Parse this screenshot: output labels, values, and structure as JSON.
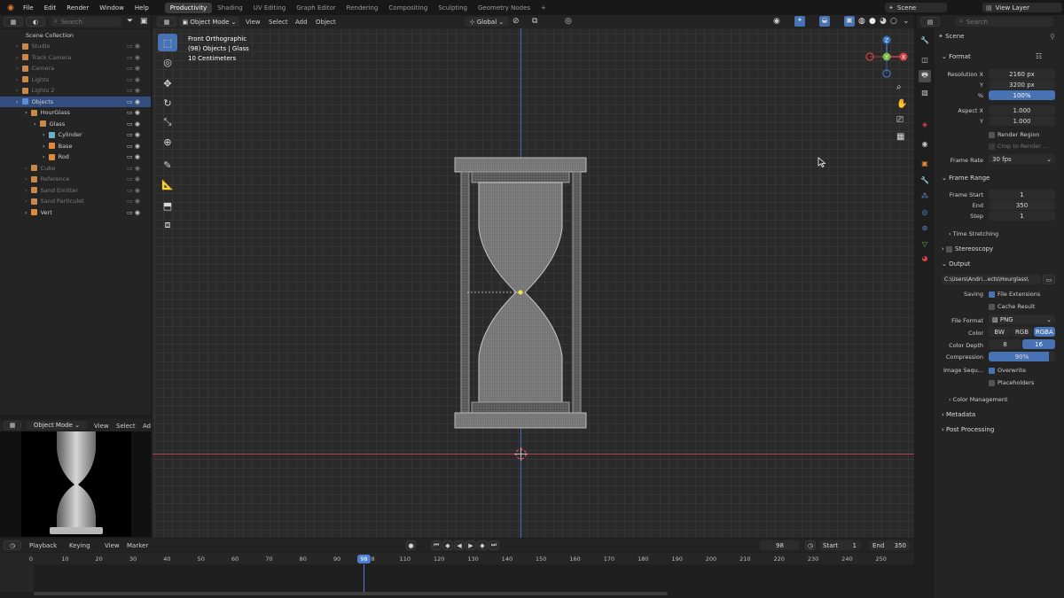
{
  "menus": [
    "File",
    "Edit",
    "Render",
    "Window",
    "Help"
  ],
  "workspaces": [
    "Productivity",
    "Shading",
    "UV Editing",
    "Graph Editor",
    "Rendering",
    "Compositing",
    "Sculpting",
    "Geometry Nodes"
  ],
  "active_workspace": "Productivity",
  "scene_name": "Scene",
  "view_layer": "View Layer",
  "search_placeholder": "Search",
  "outliner": {
    "root": "Scene Collection",
    "rows": [
      {
        "label": "Studio",
        "indent": 1,
        "dim": true,
        "color": "#c9874a"
      },
      {
        "label": "Track Camera",
        "indent": 1,
        "dim": true,
        "color": "#c9874a"
      },
      {
        "label": "Camera",
        "indent": 1,
        "dim": true,
        "color": "#c9874a"
      },
      {
        "label": "Lights",
        "indent": 1,
        "dim": true,
        "color": "#c9874a"
      },
      {
        "label": "Lights 2",
        "indent": 1,
        "dim": true,
        "color": "#c9874a"
      },
      {
        "label": "Objects",
        "indent": 1,
        "dim": false,
        "color": "#5a8fd6",
        "sel": true
      },
      {
        "label": "HourGlass",
        "indent": 2,
        "dim": false,
        "color": "#c9874a"
      },
      {
        "label": "Glass",
        "indent": 3,
        "dim": false,
        "color": "#c9874a"
      },
      {
        "label": "Cylinder",
        "indent": 4,
        "dim": false,
        "color": "#6fb0c8"
      },
      {
        "label": "Base",
        "indent": 4,
        "dim": false,
        "color": "#e08a3a"
      },
      {
        "label": "Rod",
        "indent": 4,
        "dim": false,
        "color": "#e08a3a"
      },
      {
        "label": "Cube",
        "indent": 2,
        "dim": true,
        "color": "#c9874a"
      },
      {
        "label": "Reference",
        "indent": 2,
        "dim": true,
        "color": "#c9874a"
      },
      {
        "label": "Sand Emitter",
        "indent": 2,
        "dim": true,
        "color": "#c9874a"
      },
      {
        "label": "Sand Particulet",
        "indent": 2,
        "dim": true,
        "color": "#c9874a"
      },
      {
        "label": "Vert",
        "indent": 2,
        "dim": false,
        "color": "#e08a3a"
      }
    ]
  },
  "viewport_header": {
    "mode": "Object Mode",
    "menus": [
      "View",
      "Select",
      "Add",
      "Object"
    ],
    "orientation": "Global"
  },
  "viewport_info": {
    "line1": "Front Orthographic",
    "line2": "(98) Objects | Glass",
    "line3": "10 Centimeters"
  },
  "gizmo": {
    "z": "Z",
    "y": "Y",
    "x": "X"
  },
  "preview_header": {
    "mode": "Object Mode",
    "menus": [
      "View",
      "Select",
      "Ad"
    ]
  },
  "properties": {
    "context": "Scene",
    "format_title": "Format",
    "resolution_x_label": "Resolution X",
    "resolution_x": "2160 px",
    "resolution_y_label": "Y",
    "resolution_y": "3200 px",
    "percent_label": "%",
    "percent": "100%",
    "aspect_x_label": "Aspect X",
    "aspect_x": "1.000",
    "aspect_y_label": "Y",
    "aspect_y": "1.000",
    "render_region": "Render Region",
    "crop_to_render": "Crop to Render ...",
    "frame_rate_label": "Frame Rate",
    "frame_rate": "30 fps",
    "frame_range_title": "Frame Range",
    "frame_start_label": "Frame Start",
    "frame_start": "1",
    "end_label": "End",
    "end": "350",
    "step_label": "Step",
    "step": "1",
    "time_stretching": "Time Stretching",
    "stereoscopy": "Stereoscopy",
    "output_title": "Output",
    "output_path": "C:\\Users\\Andri...ects\\Hourglass\\",
    "saving_label": "Saving",
    "file_extensions": "File Extensions",
    "cache_result": "Cache Result",
    "file_format_label": "File Format",
    "file_format": "PNG",
    "color_label": "Color",
    "color_options": [
      "BW",
      "RGB",
      "RGBA"
    ],
    "color_selected": "RGBA",
    "color_depth_label": "Color Depth",
    "color_depth_options": [
      "8",
      "16"
    ],
    "color_depth_selected": "16",
    "compression_label": "Compression",
    "compression": "90%",
    "compression_value": 0.9,
    "image_seq_label": "Image Sequ...",
    "overwrite": "Overwrite",
    "placeholders": "Placeholders",
    "color_management": "Color Management",
    "metadata": "Metadata",
    "post_processing": "Post Processing"
  },
  "timeline": {
    "menus": [
      "Playback",
      "Keying",
      "View",
      "Marker"
    ],
    "current_frame": "98",
    "start_label": "Start",
    "start": "1",
    "end_label": "End",
    "end": "350",
    "ticks": [
      "0",
      "10",
      "20",
      "30",
      "40",
      "50",
      "60",
      "70",
      "80",
      "90",
      "98",
      "110",
      "120",
      "130",
      "140",
      "150",
      "160",
      "170",
      "180",
      "190",
      "200",
      "210",
      "220",
      "230",
      "240",
      "250"
    ]
  },
  "colors": {
    "accent": "#4772b3",
    "active_frame": "#4f7fd1",
    "x_axis": "#b3404d",
    "z_axis": "#3b73c0"
  }
}
